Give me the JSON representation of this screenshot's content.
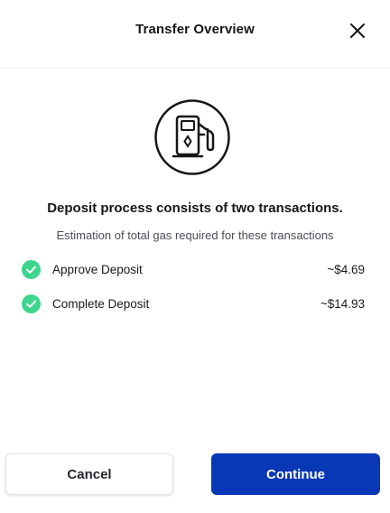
{
  "header": {
    "title": "Transfer Overview",
    "close_icon": "close-icon"
  },
  "main": {
    "icon": "gas-pump-icon",
    "headline": "Deposit process consists of two transactions.",
    "subline": "Estimation of total gas required for these transactions",
    "items": [
      {
        "label": "Approve Deposit",
        "amount": "~$4.69",
        "status": "complete"
      },
      {
        "label": "Complete Deposit",
        "amount": "~$14.93",
        "status": "complete"
      }
    ]
  },
  "footer": {
    "cancel_label": "Cancel",
    "continue_label": "Continue"
  },
  "colors": {
    "accent": "#0838b6",
    "check": "#3dd68c"
  }
}
